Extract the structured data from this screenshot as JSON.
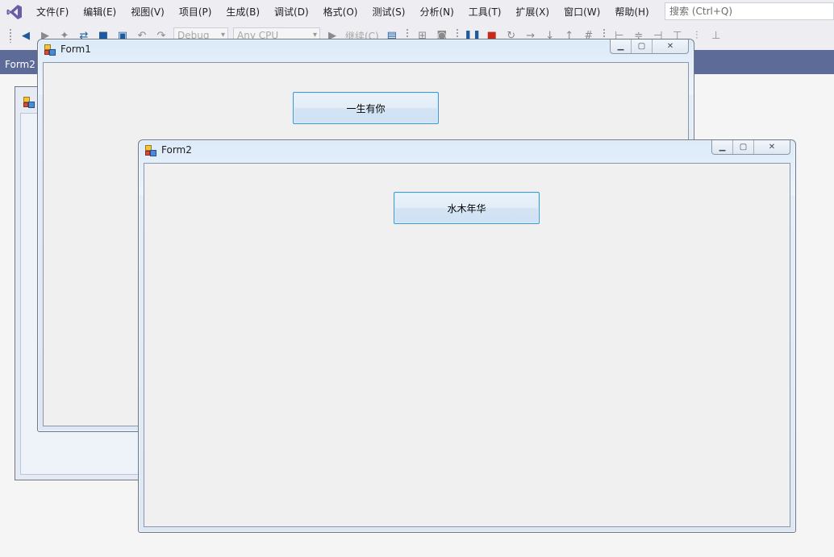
{
  "menubar": {
    "items": [
      "文件(F)",
      "编辑(E)",
      "视图(V)",
      "项目(P)",
      "生成(B)",
      "调试(D)",
      "格式(O)",
      "测试(S)",
      "分析(N)",
      "工具(T)",
      "扩展(X)",
      "窗口(W)",
      "帮助(H)"
    ],
    "search_placeholder": "搜索 (Ctrl+Q)"
  },
  "toolbar": {
    "config": "Debug",
    "platform": "Any CPU",
    "continue_label": "继续(C)"
  },
  "tabs": {
    "active": "Form2"
  },
  "form1": {
    "title": "Form1",
    "button_label": "一生有你"
  },
  "form2": {
    "title": "Form2",
    "button_label": "水木年华"
  },
  "colors": {
    "accent": "#5d6b99",
    "button_border": "#3c99d6"
  }
}
